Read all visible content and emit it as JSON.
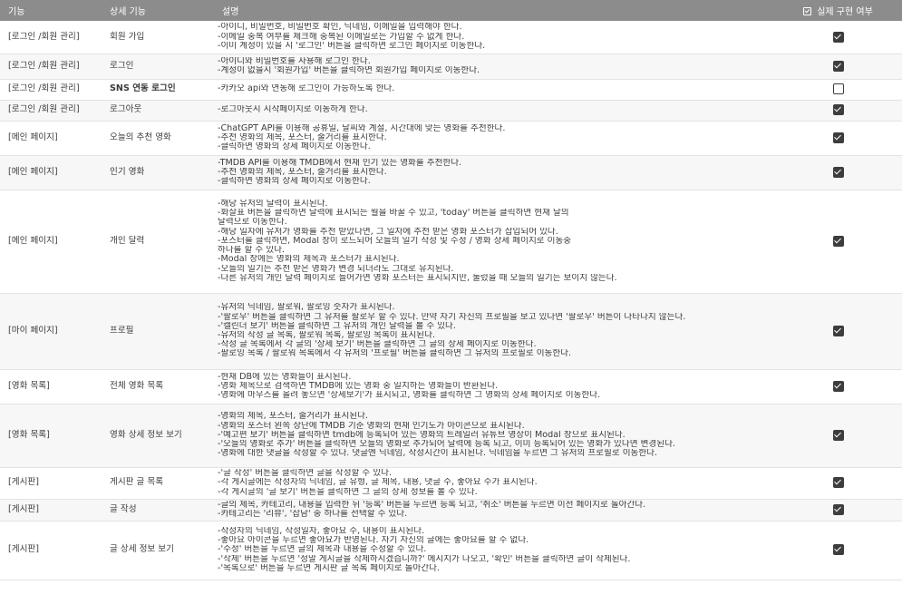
{
  "header": {
    "col1": "기능",
    "col2": "상세 기능",
    "col3": "설명",
    "col4": "실제 구현 여부",
    "col4_icon": "checkbox-icon"
  },
  "rows": [
    {
      "feature": "[로그인 /회원 관리]",
      "detail": "회원 가입",
      "lines": [
        "-아이디, 비밀번호, 비밀번호 확인, 닉네임, 이메일을 입력해야 한다.",
        "-이메일 중복 여부를 체크해 중복된 이메일로는 가입할 수 없게 한다.",
        "-이미 계정이 있을 시 '로그인' 버튼을 클릭하면 로그인 페이지로 이동한다."
      ],
      "implemented": true
    },
    {
      "feature": "[로그인 /회원 관리]",
      "detail": "로그인",
      "lines": [
        "-아이디와 비밀번호를 사용해 로그인 한다.",
        "-계정이 없을시 '회원가입' 버튼을 클릭하면 회원가입 페이지로 이동한다."
      ],
      "implemented": true
    },
    {
      "feature": "[로그인 /회원 관리]",
      "detail": "SNS 연동 로그인",
      "detail_bold": true,
      "lines": [
        "-카카오 api와 연동해 로그인이 가능하도록 한다."
      ],
      "implemented": false
    },
    {
      "feature": "[로그인 /회원 관리]",
      "detail": "로그아웃",
      "lines": [
        "-로그아웃시 시작페이지로 이동하게 한다."
      ],
      "implemented": true
    },
    {
      "feature": "[메인 페이지]",
      "detail": "오늘의 추천 영화",
      "lines": [
        "-ChatGPT API를 이용해 공휴일, 날씨와 계절, 시간대에 맞는 영화를 추천한다.",
        "-추천 영화의 제목, 포스터, 줄거리를 표시한다.",
        "-클릭하면 영화의 상세 페이지로 이동한다."
      ],
      "implemented": true
    },
    {
      "feature": "[메인 페이지]",
      "detail": "인기 영화",
      "lines": [
        "-TMDB API를 이용해 TMDB에서 현재 인기 있는 영화를 추천한다.",
        "-추천 영화의 제목, 포스터, 줄거리를 표시한다.",
        "-클릭하면 영화의 상세 페이지로 이동한다."
      ],
      "implemented": true
    },
    {
      "feature": "[메인 페이지]",
      "detail": "개인 달력",
      "lines": [
        "-해당 유저의 달력이 표시된다.",
        "-화살표 버튼을 클릭하면 달력에 표시되는 월을 바꿀 수 있고, 'today' 버튼을 클릭하면 현재 달의",
        "달력으로 이동한다.",
        "-해당 일자에 유저가 영화를 추천 받았다면, 그 일자에 추천 받은 영화 포스터가 삽입되어 있다.",
        "-포스터를 클릭하면, Modal 창이 로드되어 오늘의 일기 작성 및 수정 / 영화 상세 페이지로 이동중",
        "하나를 할 수 있다.",
        "-Modal 창에는 영화의 제목과 포스터가 표시된다.",
        "-오늘의 일기는 추천 받은 영화가 변경 되더라도 그대로 유지된다.",
        "-다른 유저의 개인 달력 페이지로 들어가면 영화 포스터는 표시되지만, 눌렀을 때 오늘의 일기는 보이지 않는다."
      ],
      "implemented": true
    },
    {
      "feature": "[마이 페이지]",
      "detail": "프로필",
      "lines": [
        "-유저의 닉네임, 팔로워, 팔로잉 숫자가 표시된다.",
        "-'팔로우' 버튼을 클릭하면 그 유저를 팔로우 할 수 있다. 만약 자기 자신의 프로필을 보고 있다면 '팔로우' 버튼이 나타나지 않는다.",
        "-'캘린더 보기' 버튼을 클릭하면 그 유저의 개인 달력을 볼 수 있다.",
        "-유저의 작성 글 목록, 팔로워 목록, 팔로잉 목록이 표시된다.",
        "-작성 글 목록에서 각 글의 '상세 보기' 버튼을 클릭하면 그 글의 상세 페이지로 이동한다.",
        "-팔로잉 목록 / 팔로워 목록에서 각 유저의 '프로필' 버튼을 클릭하면 그 유저의 프로필로 이동한다."
      ],
      "implemented": true
    },
    {
      "feature": "[영화 목록]",
      "detail": "전체 영화 목록",
      "lines": [
        "-현재 DB에 있는 영화들이 표시된다.",
        "-영화 제목으로 검색하면 TMDB에 있는 영화 중 일치하는 영화들이 반환된다.",
        "-영화에 마우스를 올려 놓으면 '상세보기'가 표시되고, 영화를 클릭하면 그 영화의 상세 페이지로 이동한다."
      ],
      "implemented": true
    },
    {
      "feature": "[영화 목록]",
      "detail": "영화 상세 정보 보기",
      "lines": [
        "-영화의 제목, 포스터, 줄거리가 표시된다.",
        "-영화의 포스터 왼쪽 상단에 TMDB 기준 영화의 현재 인기도가 아이콘으로 표시된다.",
        "-'예고편 보기' 버튼을 클릭하면 tmdb에 등록되어 있는 영화의 트레일러 유튜브 영상이 Modal 창으로 표시된다.",
        "-'오늘의 영화로 추가' 버튼을 클릭하면 오늘의 영화로 추가되어 달력에 등록 되고, 이미 등록되어 있는 영화가 있다면 변경된다.",
        "-영화에 대한 댓글을 작성할 수 있다. 댓글엔 닉네임, 작성시간이 표시된다. 닉네임을 누르면 그 유저의 프로필로 이동한다."
      ],
      "implemented": true
    },
    {
      "feature": "[게시판]",
      "detail": "게시판 글 목록",
      "lines": [
        "-'글 작성' 버튼을 클릭하면 글을 작성할 수 있다.",
        "-각 게시글에는 작성자의 닉네임, 글 유형, 글 제목, 내용, 댓글 수, 좋아요 수가 표시된다.",
        "-각 게시글의 '글 보기' 버튼을 클릭하면 그 글의 상세 정보를 볼 수 있다."
      ],
      "implemented": true
    },
    {
      "feature": "[게시판]",
      "detail": "글 작성",
      "lines": [
        "-글의 제목, 카테고리, 내용을 입력한 뒤 '등록' 버튼을 누르면 등록 되고, '취소' 버튼을 누르면 이전 페이지로 돌아간다.",
        "-카테고리는 '리뷰', '잡담' 중 하나를 선택할 수 있다."
      ],
      "implemented": true
    },
    {
      "feature": "[게시판]",
      "detail": "글 상세 정보 보기",
      "lines": [
        "-작성자의 닉네임, 작성일자, 좋아요 수, 내용이 표시된다.",
        "-좋아요 아이콘을 누르면 좋아요가 반영된다. 자기 자신의 글에는 좋아요를 할 수 없다.",
        "-'수정' 버튼을 누르면 글의 제목과 내용을 수정할 수 있다.",
        "-'삭제' 버튼을 누르면 '정말 게시글을 삭제하시겠습니까?' 메시지가 나오고, '확인' 버튼을 클릭하면 글이 삭제된다.",
        "-'목록으로' 버튼을 누르면 게시판 글 목록 페이지로 돌아간다."
      ],
      "implemented": true
    }
  ]
}
